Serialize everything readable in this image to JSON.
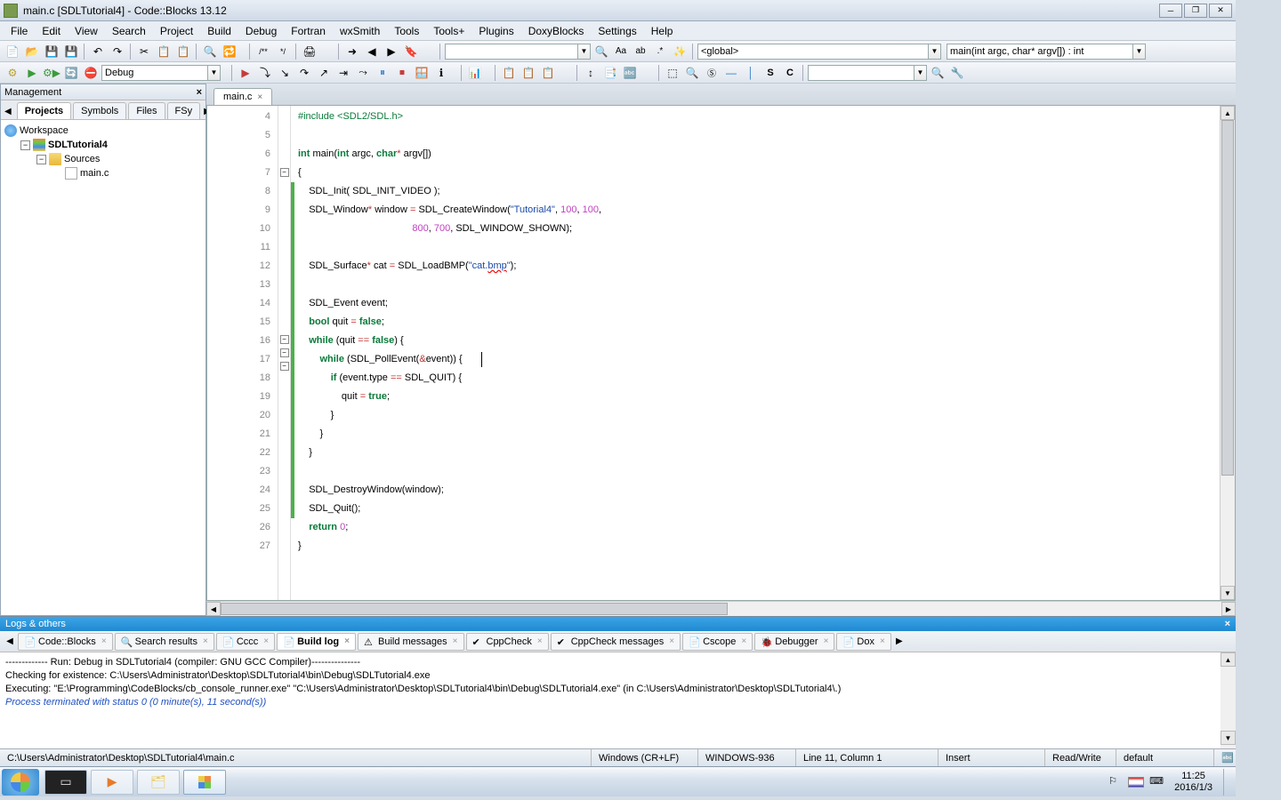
{
  "title": "main.c [SDLTutorial4] - Code::Blocks 13.12",
  "menu": [
    "File",
    "Edit",
    "View",
    "Search",
    "Project",
    "Build",
    "Debug",
    "Fortran",
    "wxSmith",
    "Tools",
    "Tools+",
    "Plugins",
    "DoxyBlocks",
    "Settings",
    "Help"
  ],
  "toolbar2": {
    "config": "Debug",
    "scope": "<global>",
    "func": "main(int argc, char* argv[]) : int"
  },
  "mgmt": {
    "title": "Management",
    "tabs": [
      "Projects",
      "Symbols",
      "Files",
      "FSy"
    ],
    "active_tab": 0,
    "tree": {
      "workspace": "Workspace",
      "project": "SDLTutorial4",
      "sources": "Sources",
      "file": "main.c"
    }
  },
  "editor": {
    "tab": "main.c",
    "first_line": 4,
    "lines": [
      {
        "n": 4,
        "fold": "",
        "chg": false,
        "html": "<span class='pp'>#include</span> <span class='pp'>&lt;SDL2/SDL.h&gt;</span>"
      },
      {
        "n": 5,
        "fold": "",
        "chg": false,
        "html": ""
      },
      {
        "n": 6,
        "fold": "",
        "chg": false,
        "html": "<span class='kw'>int</span> main(<span class='kw'>int</span> argc, <span class='kw'>char</span><span class='op'>*</span> argv[])"
      },
      {
        "n": 7,
        "fold": "-",
        "chg": false,
        "html": "{"
      },
      {
        "n": 8,
        "fold": "",
        "chg": true,
        "html": "    SDL_Init( SDL_INIT_VIDEO );"
      },
      {
        "n": 9,
        "fold": "",
        "chg": true,
        "html": "    SDL_Window<span class='op'>*</span> window <span class='op'>=</span> SDL_CreateWindow(<span class='str'>\"Tutorial4\"</span>, <span class='num'>100</span>, <span class='num'>100</span>,"
      },
      {
        "n": 10,
        "fold": "",
        "chg": true,
        "html": "                                          <span class='num'>800</span>, <span class='num'>700</span>, SDL_WINDOW_SHOWN);"
      },
      {
        "n": 11,
        "fold": "",
        "chg": true,
        "html": ""
      },
      {
        "n": 12,
        "fold": "",
        "chg": true,
        "html": "    SDL_Surface<span class='op'>*</span> cat <span class='op'>=</span> SDL_LoadBMP(<span class='str'>\"cat.<u style='text-decoration:red wavy underline'>bmp</u>\"</span>);"
      },
      {
        "n": 13,
        "fold": "",
        "chg": true,
        "html": ""
      },
      {
        "n": 14,
        "fold": "",
        "chg": true,
        "html": "    SDL_Event event;"
      },
      {
        "n": 15,
        "fold": "",
        "chg": true,
        "html": "    <span class='kw'>bool</span> quit <span class='op'>=</span> <span class='kw'>false</span>;"
      },
      {
        "n": 16,
        "fold": "-",
        "chg": true,
        "html": "    <span class='kw'>while</span> (quit <span class='op'>==</span> <span class='kw'>false</span>) {"
      },
      {
        "n": 17,
        "fold": "-",
        "chg": true,
        "html": "        <span class='kw'>while</span> (SDL_PollEvent(<span class='op'>&amp;</span>event)) {       <span class='cursor-blink'></span>"
      },
      {
        "n": 18,
        "fold": "-",
        "chg": true,
        "html": "            <span class='kw'>if</span> (event.type <span class='op'>==</span> SDL_QUIT) {"
      },
      {
        "n": 19,
        "fold": "",
        "chg": true,
        "html": "                quit <span class='op'>=</span> <span class='kw'>true</span>;"
      },
      {
        "n": 20,
        "fold": "",
        "chg": true,
        "html": "            }"
      },
      {
        "n": 21,
        "fold": "",
        "chg": true,
        "html": "        }"
      },
      {
        "n": 22,
        "fold": "",
        "chg": true,
        "html": "    }"
      },
      {
        "n": 23,
        "fold": "",
        "chg": true,
        "html": ""
      },
      {
        "n": 24,
        "fold": "",
        "chg": true,
        "html": "    SDL_DestroyWindow(window);"
      },
      {
        "n": 25,
        "fold": "",
        "chg": true,
        "html": "    SDL_Quit();"
      },
      {
        "n": 26,
        "fold": "",
        "chg": false,
        "html": "    <span class='kw'>return</span> <span class='num'>0</span>;"
      },
      {
        "n": 27,
        "fold": "",
        "chg": false,
        "html": "}"
      }
    ]
  },
  "logs": {
    "title": "Logs & others",
    "tabs": [
      "Code::Blocks",
      "Search results",
      "Cccc",
      "Build log",
      "Build messages",
      "CppCheck",
      "CppCheck messages",
      "Cscope",
      "Debugger",
      "Dox"
    ],
    "active_tab": 3,
    "icons": [
      "📄",
      "🔍",
      "📄",
      "📄",
      "⚠",
      "✔",
      "✔",
      "📄",
      "🐞",
      "📄"
    ],
    "lines": [
      {
        "cls": "",
        "text": "------------- Run: Debug in SDLTutorial4 (compiler: GNU GCC Compiler)---------------"
      },
      {
        "cls": "",
        "text": ""
      },
      {
        "cls": "",
        "text": "Checking for existence: C:\\Users\\Administrator\\Desktop\\SDLTutorial4\\bin\\Debug\\SDLTutorial4.exe"
      },
      {
        "cls": "",
        "text": "Executing: \"E:\\Programming\\CodeBlocks/cb_console_runner.exe\" \"C:\\Users\\Administrator\\Desktop\\SDLTutorial4\\bin\\Debug\\SDLTutorial4.exe\"  (in C:\\Users\\Administrator\\Desktop\\SDLTutorial4\\.)"
      },
      {
        "cls": "blue",
        "text": "Process terminated with status 0 (0 minute(s), 11 second(s))"
      }
    ]
  },
  "status": {
    "path": "C:\\Users\\Administrator\\Desktop\\SDLTutorial4\\main.c",
    "eol": "Windows (CR+LF)",
    "enc": "WINDOWS-936",
    "pos": "Line 11, Column 1",
    "ins": "Insert",
    "rw": "Read/Write",
    "profile": "default"
  },
  "tray": {
    "time": "11:25",
    "date": "2016/1/3"
  }
}
